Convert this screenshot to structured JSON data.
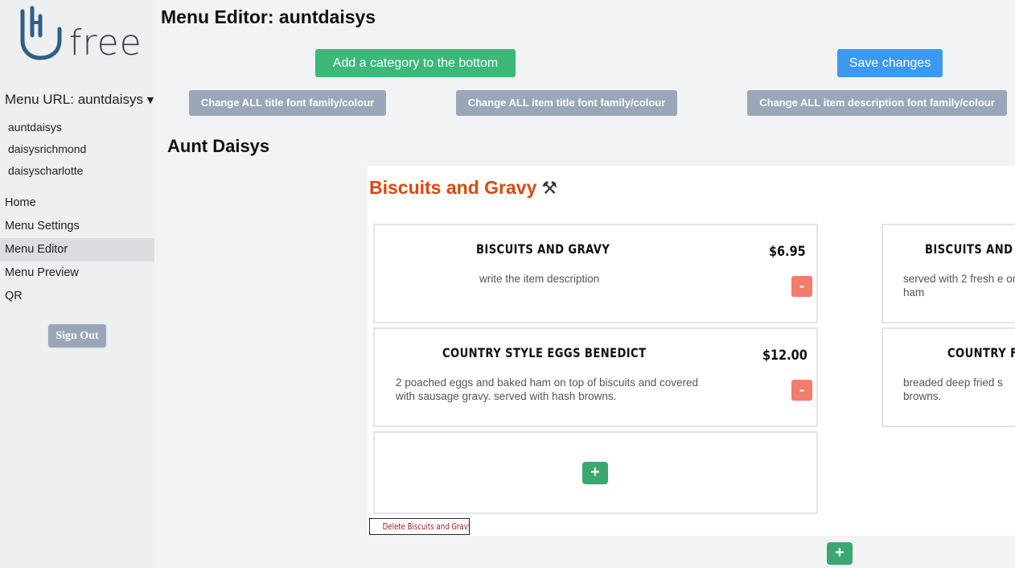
{
  "brand": {
    "logo_text": "free"
  },
  "sidebar": {
    "menu_url_label": "Menu URL: auntdaisys",
    "url_items": [
      "auntdaisys",
      "daisysrichmond",
      "daisyscharlotte"
    ],
    "nav": [
      "Home",
      "Menu Settings",
      "Menu Editor",
      "Menu Preview",
      "QR"
    ],
    "active_nav": "Menu Editor",
    "sign_out": "Sign Out"
  },
  "header": {
    "title": "Menu Editor: auntdaisys",
    "add_category": "Add a category to the bottom",
    "save": "Save changes",
    "change_title_font": "Change ALL title font family/colour",
    "change_item_title_font": "Change ALL item title font family/colour",
    "change_item_desc_font": "Change ALL item description font family/colour"
  },
  "restaurant_name": "Aunt Daisys",
  "category": {
    "title": "Biscuits and Gravy",
    "tool_icon": "⚒",
    "delete_label": "Delete Biscuits and Gravy",
    "items": [
      {
        "title": "BISCUITS AND GRAVY",
        "price": "$6.95",
        "description": "write the item description"
      },
      {
        "title": "COUNTRY STYLE EGGS BENEDICT",
        "price": "$12.00",
        "description": "2 poached eggs and baked ham on top of biscuits and covered with sausage gravy. served with hash browns."
      }
    ],
    "side_items": [
      {
        "title": "BISCUITS AND",
        "description": "served with 2 fresh e or ham"
      },
      {
        "title": "COUNTRY F",
        "description": "breaded deep fried s browns."
      }
    ]
  },
  "buttons": {
    "remove": "-",
    "add": "+"
  },
  "colors": {
    "green": "#3cb878",
    "blue": "#3d98f0",
    "gray": "#9aa7b8",
    "category_title": "#d9480f",
    "remove": "#f07d6e"
  }
}
